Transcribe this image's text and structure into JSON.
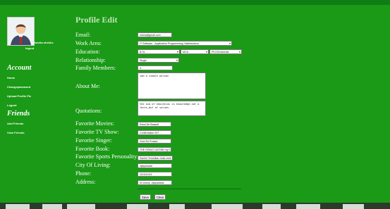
{
  "sidebar": {
    "username": "Amrita shekhs",
    "logout": "logout",
    "account_heading": "Account",
    "account_links": [
      "Home",
      "Changepassword",
      "Upload Profile Pic",
      "Logout"
    ],
    "friends_heading": "Friends",
    "friends_links": [
      "Add Friends",
      "View Friends"
    ]
  },
  "form": {
    "title": "Profile Edit",
    "labels": {
      "email": "Email:",
      "work_area": "Work Area:",
      "education": "Education:",
      "relationship": "Relationship:",
      "family_members": "Family Members:",
      "about_me": "About Me:",
      "quotations": "Quotations:",
      "fav_movies": "Favorite Movies:",
      "fav_tv": "Favorite TV Show:",
      "fav_singer": "Favorite Singer:",
      "fav_book": "Favorite Book:",
      "fav_sports": "Favorite Sports Personality:",
      "city": "City Of Living:",
      "phone": "Phone:",
      "address": "Address:"
    },
    "values": {
      "email": "srisha@gmail.com",
      "work_area": "IT Software - Application Programming, Maintenance",
      "education_1": "B.Sc",
      "education_2": "MCA",
      "education_3": "Ph.D/Doctorate",
      "relationship": "Single",
      "family_members": "4",
      "about_me": "iam a simple person",
      "quotations": "the aim of education is knowledge,not a facts,but of values.",
      "fav_movies": "Rand De Basanti",
      "fav_tv": "Confirmation 007",
      "fav_singer": "Geet Mr Prasad",
      "fav_book": "THE GREAT GATSBY by F. S",
      "fav_sports": "Sachin Tendulkar India crick",
      "city": "vijayawada",
      "phone": "1111111111",
      "address": "lic colony ,vijayawada"
    },
    "buttons": {
      "save": "Save",
      "clear": "Clear"
    }
  },
  "colors": {
    "background": "#1a9a16",
    "title": "#bfe3b6",
    "text": "#ffffff"
  }
}
